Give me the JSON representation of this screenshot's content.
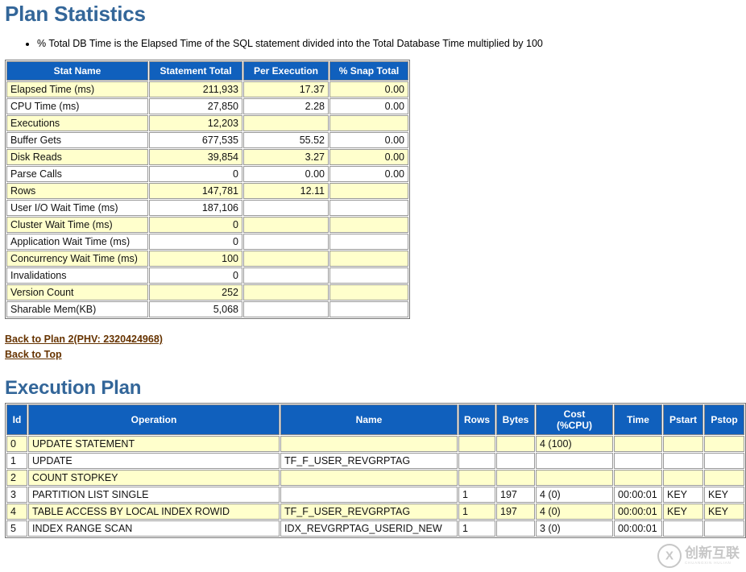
{
  "page": {
    "title": "Plan Statistics",
    "notes": [
      "% Total DB Time is the Elapsed Time of the SQL statement divided into the Total Database Time multiplied by 100"
    ]
  },
  "colors": {
    "heading": "#336699",
    "table_header_bg": "#1060bd",
    "table_header_fg": "#ffffff",
    "alt_row_bg": "#ffffcc",
    "link": "#663300",
    "watermark": "#9a9a9a"
  },
  "plan_statistics": {
    "columns": [
      "Stat Name",
      "Statement Total",
      "Per Execution",
      "% Snap Total"
    ],
    "rows": [
      {
        "stat": "Elapsed Time (ms)",
        "total": "211,933",
        "per_exec": "17.37",
        "pct_snap": "0.00"
      },
      {
        "stat": "CPU Time (ms)",
        "total": "27,850",
        "per_exec": "2.28",
        "pct_snap": "0.00"
      },
      {
        "stat": "Executions",
        "total": "12,203",
        "per_exec": "",
        "pct_snap": ""
      },
      {
        "stat": "Buffer Gets",
        "total": "677,535",
        "per_exec": "55.52",
        "pct_snap": "0.00"
      },
      {
        "stat": "Disk Reads",
        "total": "39,854",
        "per_exec": "3.27",
        "pct_snap": "0.00"
      },
      {
        "stat": "Parse Calls",
        "total": "0",
        "per_exec": "0.00",
        "pct_snap": "0.00"
      },
      {
        "stat": "Rows",
        "total": "147,781",
        "per_exec": "12.11",
        "pct_snap": ""
      },
      {
        "stat": "User I/O Wait Time (ms)",
        "total": "187,106",
        "per_exec": "",
        "pct_snap": ""
      },
      {
        "stat": "Cluster Wait Time (ms)",
        "total": "0",
        "per_exec": "",
        "pct_snap": ""
      },
      {
        "stat": "Application Wait Time (ms)",
        "total": "0",
        "per_exec": "",
        "pct_snap": ""
      },
      {
        "stat": "Concurrency Wait Time (ms)",
        "total": "100",
        "per_exec": "",
        "pct_snap": ""
      },
      {
        "stat": "Invalidations",
        "total": "0",
        "per_exec": "",
        "pct_snap": ""
      },
      {
        "stat": "Version Count",
        "total": "252",
        "per_exec": "",
        "pct_snap": ""
      },
      {
        "stat": "Sharable Mem(KB)",
        "total": "5,068",
        "per_exec": "",
        "pct_snap": ""
      }
    ]
  },
  "links": [
    {
      "label": "Back to Plan 2(PHV: 2320424968)"
    },
    {
      "label": "Back to Top"
    }
  ],
  "execution_plan": {
    "title": "Execution Plan",
    "columns": [
      "Id",
      "Operation",
      "Name",
      "Rows",
      "Bytes",
      "Cost (%CPU)",
      "Time",
      "Pstart",
      "Pstop"
    ],
    "cost_header_line1": "Cost",
    "cost_header_line2": "(%CPU)",
    "rows": [
      {
        "id": "0",
        "indent": 0,
        "operation": "UPDATE STATEMENT",
        "name": "",
        "rows": "",
        "bytes": "",
        "cost": "4 (100)",
        "time": "",
        "pstart": "",
        "pstop": ""
      },
      {
        "id": "1",
        "indent": 1,
        "operation": "UPDATE",
        "name": "TF_F_USER_REVGRPTAG",
        "rows": "",
        "bytes": "",
        "cost": "",
        "time": "",
        "pstart": "",
        "pstop": ""
      },
      {
        "id": "2",
        "indent": 2,
        "operation": "COUNT STOPKEY",
        "name": "",
        "rows": "",
        "bytes": "",
        "cost": "",
        "time": "",
        "pstart": "",
        "pstop": ""
      },
      {
        "id": "3",
        "indent": 3,
        "operation": "PARTITION LIST SINGLE",
        "name": "",
        "rows": "1",
        "bytes": "197",
        "cost": "4 (0)",
        "time": "00:00:01",
        "pstart": "KEY",
        "pstop": "KEY"
      },
      {
        "id": "4",
        "indent": 4,
        "operation": "TABLE ACCESS BY LOCAL INDEX ROWID",
        "name": "TF_F_USER_REVGRPTAG",
        "rows": "1",
        "bytes": "197",
        "cost": "4 (0)",
        "time": "00:00:01",
        "pstart": "KEY",
        "pstop": "KEY"
      },
      {
        "id": "5",
        "indent": 5,
        "operation": "INDEX RANGE SCAN",
        "name": "IDX_REVGRPTAG_USERID_NEW",
        "rows": "1",
        "bytes": "",
        "cost": "3 (0)",
        "time": "00:00:01",
        "pstart": "",
        "pstop": ""
      }
    ]
  },
  "watermark": {
    "mark": "circle-x-logo-icon",
    "text": "创新互联",
    "subtext": "CHUANGXIN HULIAN"
  }
}
